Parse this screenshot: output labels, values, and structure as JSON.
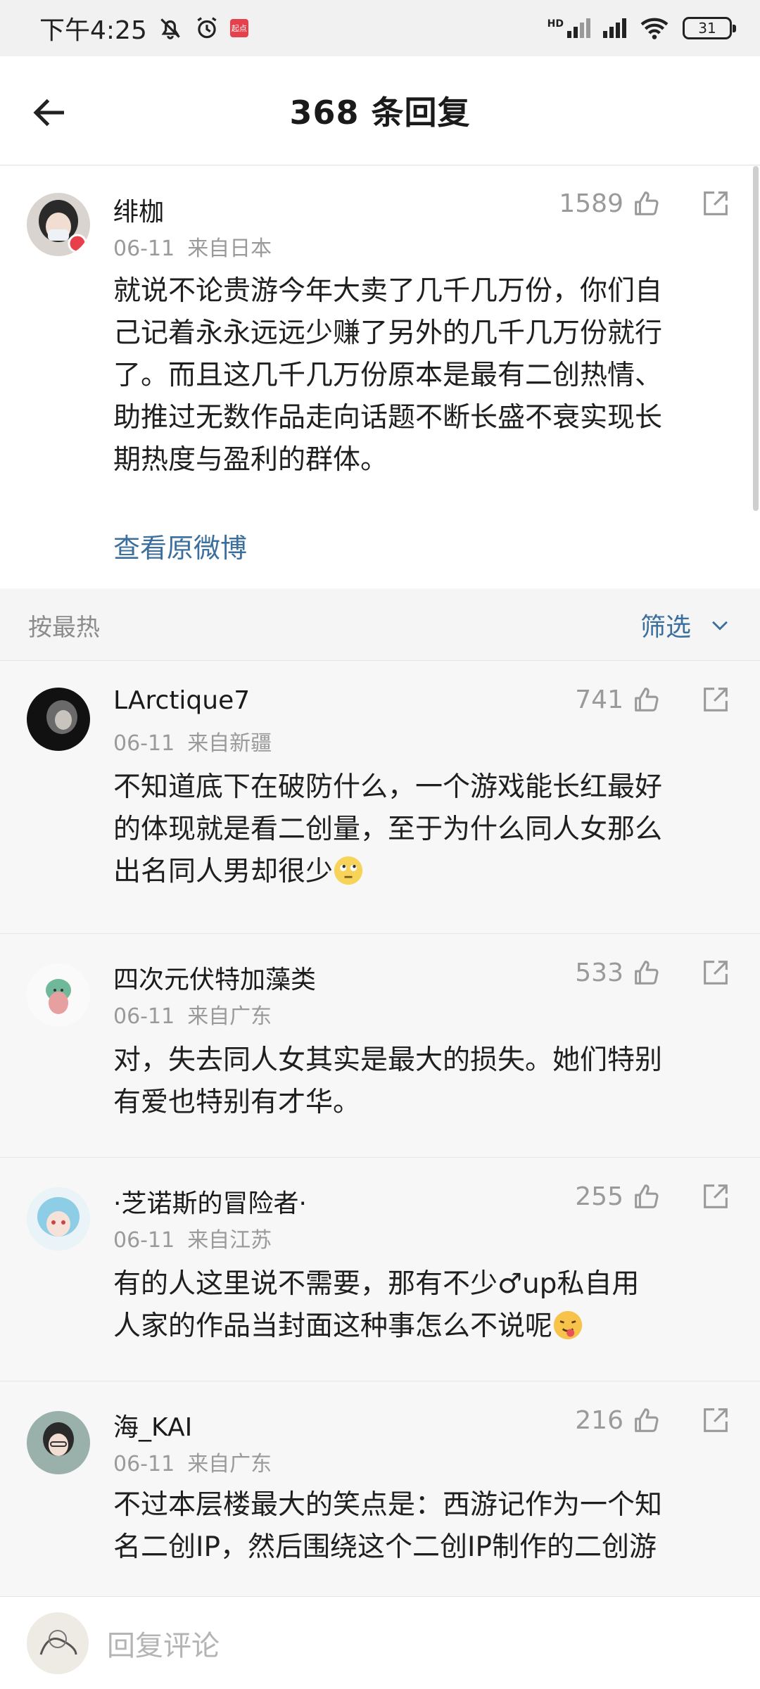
{
  "status_bar": {
    "time": "下午4:25",
    "badge_text": "起点",
    "network_label": "HD",
    "battery": "31"
  },
  "nav": {
    "title": "368 条回复"
  },
  "post": {
    "username": "绯枷",
    "date": "06-11",
    "location": "来自日本",
    "likes": "1589",
    "lines": [
      "就说不论贵游今年大卖了几千几万份，你们自",
      "己记着永永远远少赚了另外的几千几万份就行",
      "了。而且这几千几万份原本是最有二创热情、",
      "助推过无数作品走向话题不断长盛不衰实现长",
      "期热度与盈利的群体。"
    ],
    "view_original": "查看原微博"
  },
  "sort": {
    "label": "按最热",
    "filter_label": "筛选"
  },
  "comments": [
    {
      "username": "LArctique7",
      "date": "06-11",
      "location": "来自新疆",
      "likes": "741",
      "lines": [
        "不知道底下在破防什么，一个游戏能长红最好",
        "的体现就是看二创量，至于为什么同人女那么",
        "出名同人男却很少"
      ],
      "emoji": "eyeroll-emoji"
    },
    {
      "username": "四次元伏特加藻类",
      "date": "06-11",
      "location": "来自广东",
      "likes": "533",
      "lines": [
        "对，失去同人女其实是最大的损失。她们特别",
        "有爱也特别有才华。"
      ]
    },
    {
      "username": "·芝诺斯的冒险者·",
      "date": "06-11",
      "location": "来自江苏",
      "likes": "255",
      "lines": [
        "有的人这里说不需要，那有不少♂up私自用",
        "人家的作品当封面这种事怎么不说呢"
      ],
      "emoji": "tongue-emoji"
    },
    {
      "username": "海_KAI",
      "date": "06-11",
      "location": "来自广东",
      "likes": "216",
      "lines": [
        "不过本层楼最大的笑点是：西游记作为一个知",
        "名二创IP，然后围绕这个二创IP制作的二创游"
      ]
    }
  ],
  "reply_bar": {
    "placeholder": "回复评论"
  },
  "colors": {
    "link": "#3b6f9e",
    "meta": "#9a9a9a",
    "background": "#f7f7f7"
  }
}
